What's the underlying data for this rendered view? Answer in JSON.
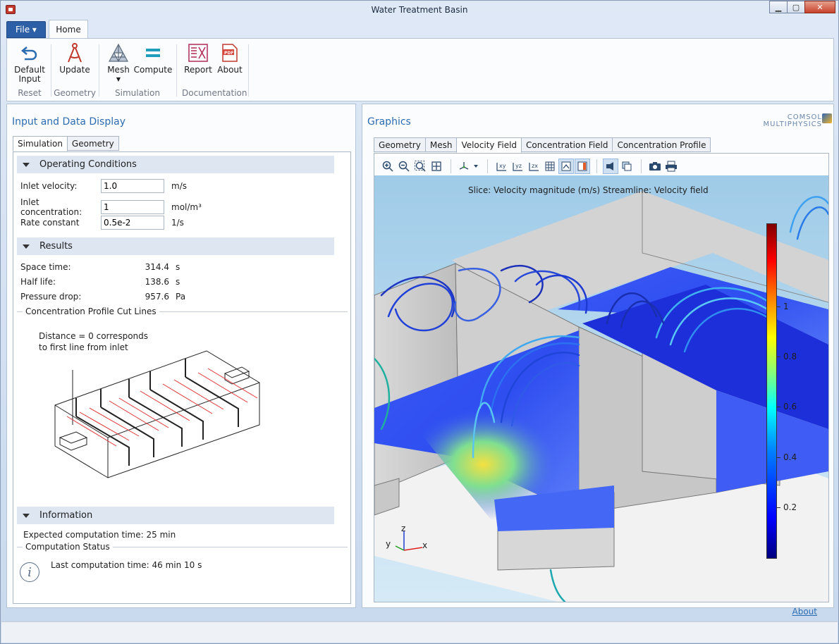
{
  "window": {
    "title": "Water Treatment Basin"
  },
  "ribbon": {
    "file_label": "File ▾",
    "home_label": "Home",
    "buttons": {
      "default_input": "Default Input",
      "update": "Update",
      "mesh": "Mesh",
      "compute": "Compute",
      "report": "Report",
      "about": "About"
    },
    "groups": {
      "reset": "Reset",
      "geometry": "Geometry",
      "simulation": "Simulation",
      "documentation": "Documentation"
    }
  },
  "left": {
    "title": "Input and Data Display",
    "tabs": [
      "Simulation",
      "Geometry"
    ],
    "operating": {
      "header": "Operating Conditions",
      "rows": [
        {
          "label": "Inlet velocity:",
          "value": "1.0",
          "unit": "m/s"
        },
        {
          "label": "Inlet concentration:",
          "value": "1",
          "unit": "mol/m³"
        },
        {
          "label": "Rate constant",
          "value": "0.5e-2",
          "unit": "1/s"
        }
      ]
    },
    "results": {
      "header": "Results",
      "rows": [
        {
          "label": "Space time:",
          "value": "314.4",
          "unit": "s"
        },
        {
          "label": "Half life:",
          "value": "138.6",
          "unit": "s"
        },
        {
          "label": "Pressure drop:",
          "value": "957.6",
          "unit": "Pa"
        }
      ]
    },
    "cut_lines": {
      "label": "Concentration Profile Cut Lines",
      "note_line1": "Distance = 0 corresponds",
      "note_line2": "to first line from inlet"
    },
    "information": {
      "header": "Information",
      "expected": "Expected computation time: 25 min",
      "status_label": "Computation Status",
      "last": "Last computation time: 46 min 10 s"
    }
  },
  "right": {
    "title": "Graphics",
    "brand_line1": "COMSOL",
    "brand_line2": "MULTIPHYSICS",
    "tabs": [
      "Geometry",
      "Mesh",
      "Velocity Field",
      "Concentration Field",
      "Concentration Profile"
    ],
    "plot_title": "Slice: Velocity magnitude (m/s)  Streamline: Velocity field",
    "colorbar_labels": [
      "1",
      "0.8",
      "0.6",
      "0.4",
      "0.2"
    ],
    "axes": {
      "x": "x",
      "y": "y",
      "z": "z"
    }
  },
  "footer": {
    "about_link": "About"
  },
  "icons": [
    "undo-icon",
    "compass-icon",
    "mesh-icon",
    "equals-icon",
    "report-icon",
    "pdf-icon",
    "zoom-in-icon",
    "zoom-out-icon",
    "zoom-box-icon",
    "zoom-extents-icon",
    "axes-orientation-icon",
    "xy-view-icon",
    "yz-view-icon",
    "zx-view-icon",
    "grid-icon",
    "legend-icon",
    "colorbar-icon",
    "scene-light-icon",
    "transparency-icon",
    "camera-icon",
    "print-icon",
    "info-icon"
  ]
}
